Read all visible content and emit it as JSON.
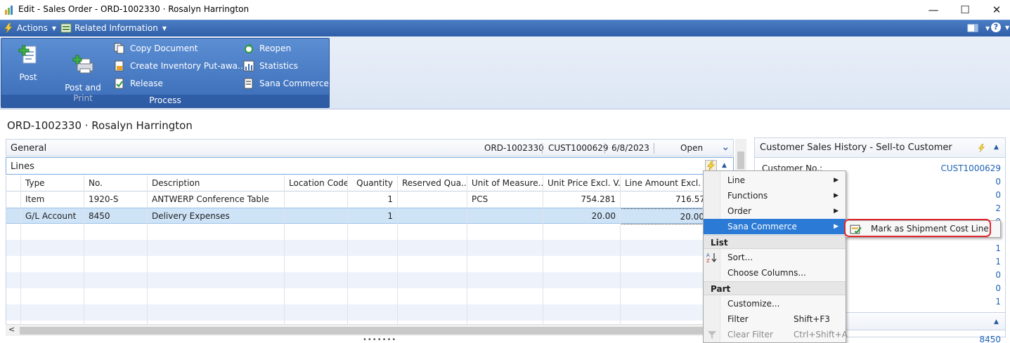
{
  "window": {
    "title": "Edit - Sales Order - ORD-1002330 · Rosalyn Harrington",
    "minimize_glyph": "—",
    "maximize_glyph": "☐",
    "close_glyph": "✕"
  },
  "commandbar": {
    "actions_label": "Actions",
    "related_label": "Related Information",
    "dropdown_glyph": "▼",
    "help_glyph": "?"
  },
  "ribbon": {
    "post_label": "Post",
    "post_print_label": "Post and\nPrint",
    "copy_document": "Copy Document",
    "create_inventory": "Create Inventory Put-awa...",
    "release": "Release",
    "reopen": "Reopen",
    "statistics": "Statistics",
    "sana_commerce": "Sana Commerce",
    "group_caption": "Process"
  },
  "page": {
    "title": "ORD-1002330 · Rosalyn Harrington"
  },
  "general_tab": {
    "label": "General",
    "order_no": "ORD-1002330",
    "customer_no": "CUST1000629",
    "date": "6/8/2023",
    "status": "Open",
    "chevron": "⌄"
  },
  "lines_tab": {
    "label": "Lines",
    "collapse_glyph": "▲"
  },
  "grid": {
    "columns": [
      "Type",
      "No.",
      "Description",
      "Location Code",
      "Quantity",
      "Reserved Qua...",
      "Unit of Measure...",
      "Unit Price Excl. V...",
      "Line Amount Excl. ..."
    ],
    "rows": [
      [
        "Item",
        "1920-S",
        "ANTWERP Conference Table",
        "",
        "1",
        "",
        "PCS",
        "754.281",
        "716.57"
      ],
      [
        "G/L Account",
        "8450",
        "Delivery Expenses",
        "",
        "1",
        "",
        "",
        "20.00",
        "20.00"
      ]
    ]
  },
  "factbox": {
    "title": "Customer Sales History - Sell-to Customer",
    "customer_label": "Customer No.:",
    "customer_value": "CUST1000629",
    "values": [
      "0",
      "0",
      "2",
      "0",
      "1",
      "1",
      "0",
      "0"
    ],
    "bottom_value": "8450"
  },
  "context_menu": {
    "line": "Line",
    "functions": "Functions",
    "order": "Order",
    "sana_commerce": "Sana Commerce",
    "list_section": "List",
    "sort": "Sort...",
    "choose_columns": "Choose Columns...",
    "part_section": "Part",
    "customize": "Customize...",
    "filter": "Filter",
    "filter_shortcut": "Shift+F3",
    "clear_filter": "Clear Filter",
    "clear_filter_shortcut": "Ctrl+Shift+A",
    "submenu_arrow": "▶"
  },
  "submenu": {
    "mark_shipment": "Mark as Shipment Cost Line"
  },
  "misc": {
    "resize_dots": "•••••••",
    "scroll_left": "<"
  }
}
